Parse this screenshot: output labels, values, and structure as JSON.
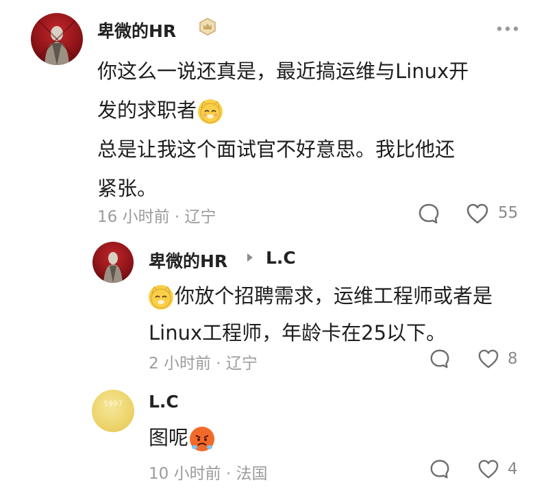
{
  "comments": [
    {
      "username": "卑微的HR",
      "text_lines": [
        "你这么一说还真是，最近搞运维与Linux开",
        "发的求职者",
        "总是让我这个面试官不好意思。我比他还",
        "紧张。"
      ],
      "meta": "16 小时前 · 辽宁",
      "likes": "55",
      "more_icon": "more-dots-icon",
      "badge_icon": "crown-badge-icon"
    }
  ],
  "replies": [
    {
      "username": "卑微的HR",
      "reply_to": "L.C",
      "text_lines": [
        "你放个招聘需求，运维工程师或者是",
        "Linux工程师，年龄卡在25以下。"
      ],
      "meta": "2 小时前 · 辽宁",
      "likes": "8"
    },
    {
      "username": "L.C",
      "avatar_text": "5997",
      "text": "图呢",
      "meta": "10 小时前 · 法国",
      "likes": "4"
    }
  ],
  "icons": {
    "comment": "comment-bubble-icon",
    "like": "heart-icon",
    "reply_arrow": "reply-arrow-icon",
    "cat_emoji": "cat-emoji-icon",
    "angry_emoji": "angry-emoji-icon"
  },
  "colors": {
    "text": "#1e1e1e",
    "meta": "#9b9b9b",
    "avatar_red": "#c0262a",
    "avatar_yellow": "#ecd46a",
    "emoji_yellow": "#f9cf4a",
    "emoji_angry": "#f26a2a"
  }
}
